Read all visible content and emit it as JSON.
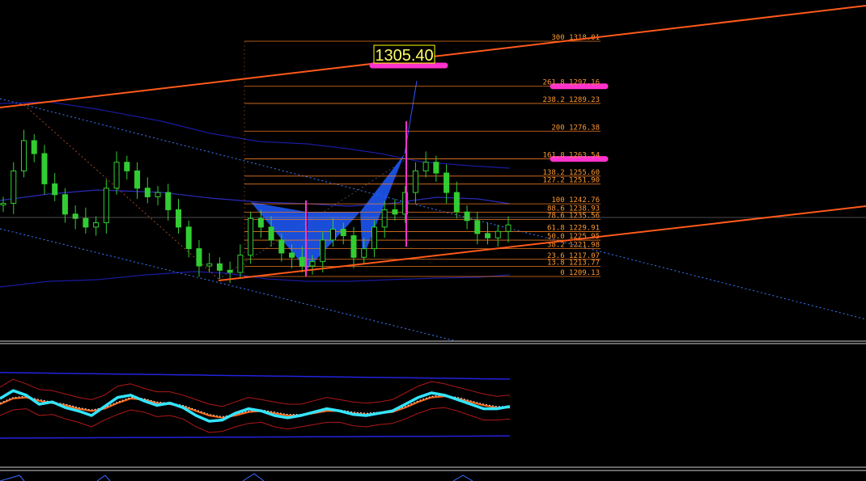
{
  "chart_data": {
    "type": "candlestick",
    "title": "",
    "price_range": [
      1173.0,
      1330.0
    ],
    "colors": {
      "background": "#000000",
      "candle": "#32CD32",
      "fib_line": "#E87722",
      "fib_label": "#FF9933",
      "channel_upper": "#FF5A1A",
      "pattern_fill": "#1E5CFF",
      "marker": "#FF33CC",
      "price_box_border": "#FFFF00",
      "price_box_text": "#FFFF66",
      "mid_band": "#3B3BCC",
      "dotted_channel": "#3A7BFF",
      "oscillator_main": "#33E5FF",
      "oscillator_signal": "#FF6A1A"
    },
    "projected_price": "1305.40",
    "fib_levels": [
      {
        "ratio": "300",
        "price": 1318.01,
        "label": "300 1318.01",
        "highlight": false
      },
      {
        "ratio": "261.8",
        "price": 1297.16,
        "label": "261.8 1297.16",
        "highlight": true
      },
      {
        "ratio": "238.2",
        "price": 1289.23,
        "label": "238.2 1289.23",
        "highlight": false
      },
      {
        "ratio": "200",
        "price": 1276.38,
        "label": "200 1276.38",
        "highlight": false
      },
      {
        "ratio": "161.8",
        "price": 1263.54,
        "label": "161.8 1263.54",
        "highlight": true
      },
      {
        "ratio": "138.2",
        "price": 1255.6,
        "label": "138.2 1255.60",
        "highlight": false
      },
      {
        "ratio": "127.2",
        "price": 1251.9,
        "label": "127.2 1251.90",
        "highlight": false
      },
      {
        "ratio": "100",
        "price": 1242.76,
        "label": "100 1242.76",
        "highlight": false
      },
      {
        "ratio": "88.6",
        "price": 1238.93,
        "label": "88.6 1238.93",
        "highlight": false
      },
      {
        "ratio": "78.6",
        "price": 1235.56,
        "label": "78.6 1235.56",
        "highlight": false
      },
      {
        "ratio": "61.8",
        "price": 1229.91,
        "label": "61.8 1229.91",
        "highlight": false
      },
      {
        "ratio": "50.0",
        "price": 1225.95,
        "label": "50.0 1225.95",
        "highlight": false
      },
      {
        "ratio": "38.2",
        "price": 1221.98,
        "label": "38.2 1221.98",
        "highlight": false
      },
      {
        "ratio": "23.6",
        "price": 1217.07,
        "label": "23.6 1217.07",
        "highlight": false
      },
      {
        "ratio": "13.8",
        "price": 1213.77,
        "label": "13.8 1213.77",
        "highlight": false
      },
      {
        "ratio": "0",
        "price": 1209.13,
        "label": "0 1209.13",
        "highlight": false
      }
    ],
    "close_series": [
      1243,
      1258,
      1272,
      1266,
      1252,
      1247,
      1238,
      1236,
      1232,
      1234,
      1250,
      1262,
      1258,
      1250,
      1246,
      1248,
      1240,
      1232,
      1222,
      1214,
      1215,
      1212,
      1211,
      1219,
      1236,
      1232,
      1226,
      1220,
      1218,
      1214,
      1216,
      1226,
      1231,
      1228,
      1218,
      1222,
      1232,
      1240,
      1238,
      1248,
      1258,
      1262,
      1257,
      1248,
      1239,
      1235,
      1229,
      1227,
      1230,
      1233
    ],
    "oscillator": {
      "main": [
        55,
        62,
        58,
        50,
        52,
        47,
        44,
        40,
        48,
        56,
        58,
        53,
        49,
        51,
        47,
        40,
        35,
        36,
        42,
        46,
        44,
        40,
        38,
        40,
        43,
        46,
        44,
        41,
        40,
        42,
        44,
        50,
        56,
        60,
        58,
        54,
        50,
        46,
        46,
        48
      ],
      "signal": [
        50,
        55,
        56,
        53,
        51,
        49,
        46,
        44,
        46,
        51,
        55,
        54,
        51,
        50,
        48,
        44,
        40,
        38,
        40,
        43,
        44,
        42,
        40,
        40,
        42,
        44,
        44,
        42,
        41,
        42,
        43,
        47,
        52,
        56,
        57,
        55,
        52,
        49,
        47,
        47
      ],
      "range": [
        0,
        100
      ]
    }
  }
}
